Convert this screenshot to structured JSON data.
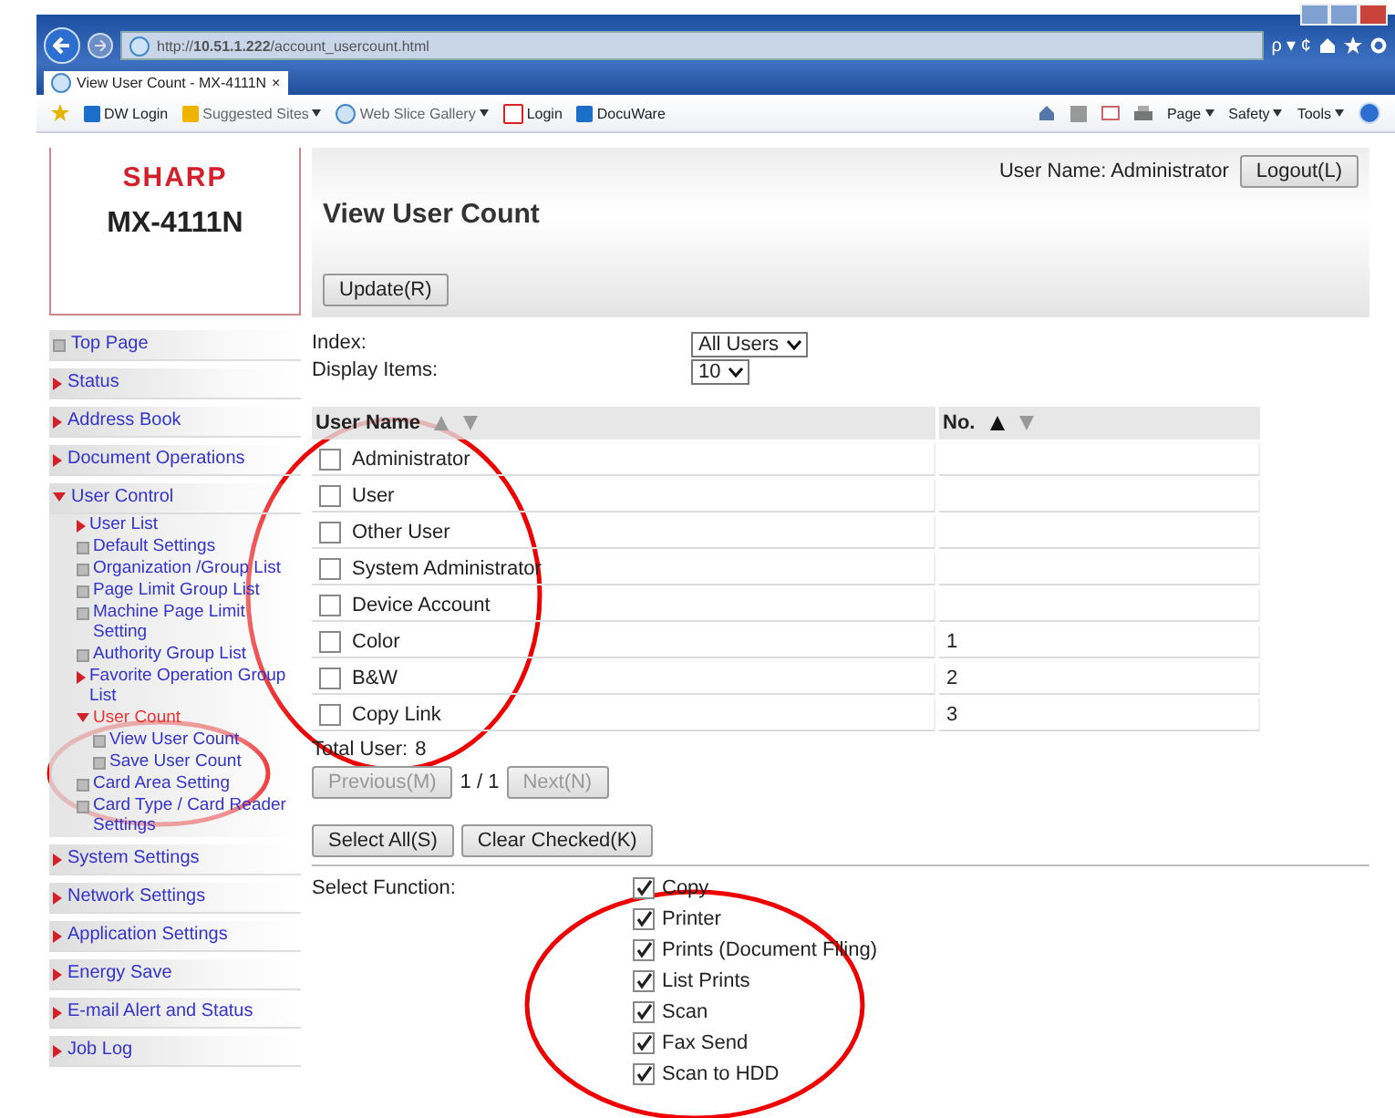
{
  "browser": {
    "url": "http://**10.51.1.222**/account_usercount.html",
    "search_glyph": "ρ ▾ ¢",
    "tab": {
      "title": "View User Count - MX-4111N",
      "close": "×"
    },
    "favorites": [
      {
        "label": "DW Login",
        "kind": "dw",
        "menu": false
      },
      {
        "label": "Suggested Sites",
        "kind": "bing",
        "menu": true
      },
      {
        "label": "Web Slice Gallery",
        "kind": "ie",
        "menu": true
      },
      {
        "label": "Login",
        "kind": "s",
        "menu": false
      },
      {
        "label": "DocuWare",
        "kind": "dw",
        "menu": false
      }
    ],
    "commands": [
      {
        "label": "Page"
      },
      {
        "label": "Safety"
      },
      {
        "label": "Tools"
      }
    ]
  },
  "sidebar": {
    "brand": "SHARP",
    "model": "MX-4111N",
    "items": [
      {
        "label": "Top Page",
        "kind": "leaf",
        "selected": false
      },
      {
        "label": "Status",
        "kind": "collapsed",
        "selected": false
      },
      {
        "label": "Address Book",
        "kind": "collapsed",
        "selected": false
      },
      {
        "label": "Document Operations",
        "kind": "collapsed",
        "selected": false
      },
      {
        "label": "User Control",
        "kind": "expanded",
        "selected": false,
        "children": [
          {
            "label": "User List",
            "kind": "collapsed",
            "selected": false
          },
          {
            "label": "Default Settings",
            "kind": "leaf",
            "selected": false
          },
          {
            "label": "Organization /Group List",
            "kind": "leaf",
            "selected": false
          },
          {
            "label": "Page Limit Group List",
            "kind": "leaf",
            "selected": false
          },
          {
            "label": "Machine Page Limit Setting",
            "kind": "leaf",
            "selected": false
          },
          {
            "label": "Authority Group List",
            "kind": "leaf",
            "selected": false
          },
          {
            "label": "Favorite Operation Group List",
            "kind": "collapsed",
            "selected": false
          },
          {
            "label": "User Count",
            "kind": "expanded",
            "selected": true,
            "children": [
              {
                "label": "View User Count",
                "kind": "leaf",
                "selected": false
              },
              {
                "label": "Save User Count",
                "kind": "leaf",
                "selected": false
              }
            ]
          },
          {
            "label": "Card Area Setting",
            "kind": "leaf",
            "selected": false
          },
          {
            "label": "Card Type / Card Reader Settings",
            "kind": "leaf",
            "selected": false
          }
        ]
      },
      {
        "label": "System Settings",
        "kind": "collapsed",
        "selected": false
      },
      {
        "label": "Network Settings",
        "kind": "collapsed",
        "selected": false
      },
      {
        "label": "Application Settings",
        "kind": "collapsed",
        "selected": false
      },
      {
        "label": "Energy Save",
        "kind": "collapsed",
        "selected": false
      },
      {
        "label": "E-mail Alert and Status",
        "kind": "collapsed",
        "selected": false
      },
      {
        "label": "Job Log",
        "kind": "collapsed",
        "selected": false
      }
    ]
  },
  "header": {
    "user": "User Name: Administrator",
    "logout": "Logout(L)",
    "title": "View User Count",
    "update": "Update(R)"
  },
  "filters": [
    {
      "label": "Index:",
      "value": "All Users"
    },
    {
      "label": "Display Items:",
      "value": "10"
    }
  ],
  "table": {
    "columns": [
      {
        "label": "User Name",
        "sorted": false
      },
      {
        "label": "No.",
        "sorted": true
      }
    ],
    "rows": [
      {
        "name": "Administrator",
        "no": "",
        "checked": false
      },
      {
        "name": "User",
        "no": "",
        "checked": false
      },
      {
        "name": "Other User",
        "no": "",
        "checked": false
      },
      {
        "name": "System Administrator",
        "no": "",
        "checked": false
      },
      {
        "name": "Device Account",
        "no": "",
        "checked": false
      },
      {
        "name": "Color",
        "no": "1",
        "checked": false
      },
      {
        "name": "B&W",
        "no": "2",
        "checked": false
      },
      {
        "name": "Copy Link",
        "no": "3",
        "checked": false
      }
    ]
  },
  "total": {
    "label": "Total User:",
    "value": "8"
  },
  "pager": {
    "previous": {
      "label": "Previous(M)",
      "disabled": true
    },
    "page": "1 / 1",
    "next": {
      "label": "Next(N)",
      "disabled": true
    }
  },
  "actions": [
    "Select All(S)",
    "Clear Checked(K)"
  ],
  "functions": {
    "label": "Select Function:",
    "items": [
      {
        "label": "Copy",
        "checked": true
      },
      {
        "label": "Printer",
        "checked": true
      },
      {
        "label": "Prints (Document Filing)",
        "checked": true
      },
      {
        "label": "List Prints",
        "checked": true
      },
      {
        "label": "Scan",
        "checked": true
      },
      {
        "label": "Fax Send",
        "checked": true
      },
      {
        "label": "Scan to HDD",
        "checked": true
      }
    ]
  }
}
